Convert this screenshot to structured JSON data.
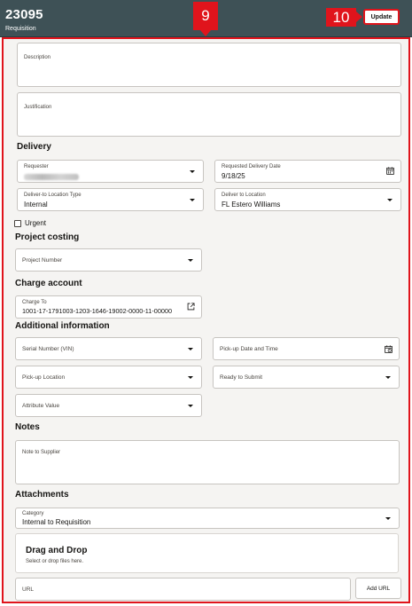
{
  "header": {
    "requisition_number": "23095",
    "subtitle": "Requisition",
    "update_label": "Update"
  },
  "callouts": {
    "panel_marker": "9",
    "update_marker": "10"
  },
  "form": {
    "description": {
      "label": "Description",
      "value": ""
    },
    "justification": {
      "label": "Justification",
      "value": ""
    },
    "delivery": {
      "title": "Delivery",
      "requester": {
        "label": "Requester",
        "value": ""
      },
      "requested_delivery_date": {
        "label": "Requested Delivery Date",
        "value": "9/18/25"
      },
      "deliver_to_location_type": {
        "label": "Deliver-to Location Type",
        "value": "Internal"
      },
      "deliver_to_location": {
        "label": "Deliver to Location",
        "value": "FL Estero Williams"
      },
      "urgent": {
        "label": "Urgent",
        "checked": false
      }
    },
    "project_costing": {
      "title": "Project costing",
      "project_number": {
        "placeholder": "Project Number"
      }
    },
    "charge_account": {
      "title": "Charge account",
      "charge_to": {
        "label": "Charge To",
        "value": "1001-17-1791003-1203-1646-19002-0000-11-00000"
      }
    },
    "additional_information": {
      "title": "Additional information",
      "serial_number": {
        "placeholder": "Serial Number (VIN)"
      },
      "pickup_date_time": {
        "placeholder": "Pick-up Date and Time"
      },
      "pickup_location": {
        "placeholder": "Pick-up Location"
      },
      "status": {
        "placeholder": "Ready to Submit"
      },
      "attribute_value": {
        "placeholder": "Attribute Value"
      }
    },
    "notes": {
      "title": "Notes",
      "note_to_supplier": {
        "label": "Note to Supplier",
        "value": ""
      }
    },
    "attachments": {
      "title": "Attachments",
      "category": {
        "label": "Category",
        "value": "Internal to Requisition"
      },
      "drag_drop_title": "Drag and Drop",
      "drag_drop_sub": "Select or drop files here.",
      "url": {
        "placeholder": "URL"
      },
      "add_url_label": "Add URL"
    }
  },
  "icons": {
    "dropdown": "chevron-down-icon",
    "calendar": "calendar-icon",
    "external_link": "external-link-icon"
  },
  "colors": {
    "header_bg": "#3e5156",
    "highlight": "#e0141c",
    "panel_bg": "#f5f4f2"
  }
}
